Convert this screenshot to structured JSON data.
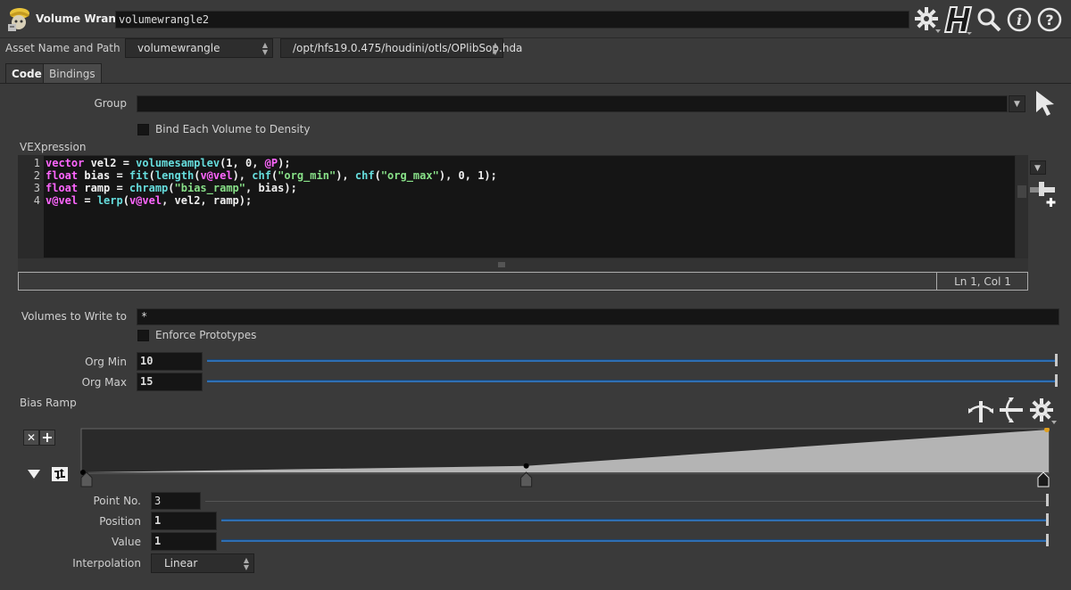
{
  "header": {
    "node_type": "Volume Wrangle",
    "node_name": "volumewrangle2"
  },
  "asset": {
    "label": "Asset Name and Path",
    "name_value": "volumewrangle",
    "path_value": "/opt/hfs19.0.475/houdini/otls/OPlibSop.hda"
  },
  "tabs": [
    {
      "label": "Code"
    },
    {
      "label": "Bindings"
    }
  ],
  "group": {
    "label": "Group",
    "value": ""
  },
  "bind_each": {
    "label": "Bind Each Volume to Density"
  },
  "vexpression": {
    "label": "VEXpression",
    "lines": [
      {
        "num": "1",
        "tokens": [
          [
            "kw",
            "vector"
          ],
          [
            "ident",
            " vel2 = "
          ],
          [
            "fn",
            "volumesamplev"
          ],
          [
            "ident",
            "(1, 0, "
          ],
          [
            "attr",
            "@P"
          ],
          [
            "ident",
            ");"
          ]
        ]
      },
      {
        "num": "2",
        "tokens": [
          [
            "kw",
            "float"
          ],
          [
            "ident",
            " bias = "
          ],
          [
            "fn",
            "fit"
          ],
          [
            "ident",
            "("
          ],
          [
            "fn",
            "length"
          ],
          [
            "ident",
            "("
          ],
          [
            "attr",
            "v@vel"
          ],
          [
            "ident",
            "), "
          ],
          [
            "fn",
            "chf"
          ],
          [
            "ident",
            "("
          ],
          [
            "str",
            "\"org_min\""
          ],
          [
            "ident",
            "), "
          ],
          [
            "fn",
            "chf"
          ],
          [
            "ident",
            "("
          ],
          [
            "str",
            "\"org_max\""
          ],
          [
            "ident",
            "), 0, 1);"
          ]
        ]
      },
      {
        "num": "3",
        "tokens": [
          [
            "kw",
            "float"
          ],
          [
            "ident",
            " ramp = "
          ],
          [
            "fn",
            "chramp"
          ],
          [
            "ident",
            "("
          ],
          [
            "str",
            "\"bias_ramp\""
          ],
          [
            "ident",
            ", bias);"
          ]
        ]
      },
      {
        "num": "4",
        "tokens": [
          [
            "attr",
            "v@vel"
          ],
          [
            "ident",
            " = "
          ],
          [
            "fn",
            "lerp"
          ],
          [
            "ident",
            "("
          ],
          [
            "attr",
            "v@vel"
          ],
          [
            "ident",
            ", vel2, ramp);"
          ]
        ]
      }
    ],
    "status": "Ln 1, Col 1"
  },
  "volumes_write": {
    "label": "Volumes to Write to",
    "value": "*"
  },
  "enforce": {
    "label": "Enforce Prototypes"
  },
  "org_min": {
    "label": "Org Min",
    "value": "10"
  },
  "org_max": {
    "label": "Org Max",
    "value": "15"
  },
  "bias_ramp": {
    "label": "Bias Ramp",
    "points": [
      {
        "position": 0,
        "value": 0
      },
      {
        "position": 0.46,
        "value": 0.15
      },
      {
        "position": 1,
        "value": 1
      }
    ],
    "point_no": {
      "label": "Point No.",
      "value": "3"
    },
    "position": {
      "label": "Position",
      "value": "1"
    },
    "value": {
      "label": "Value",
      "value": "1"
    },
    "interpolation": {
      "label": "Interpolation",
      "value": "Linear"
    }
  },
  "icons": {
    "node_icon": "volume-wrangle-icon",
    "gear": "gear-icon",
    "houdini": "houdini-h-icon",
    "search": "search-icon",
    "info": "info-icon",
    "help": "help-icon"
  }
}
